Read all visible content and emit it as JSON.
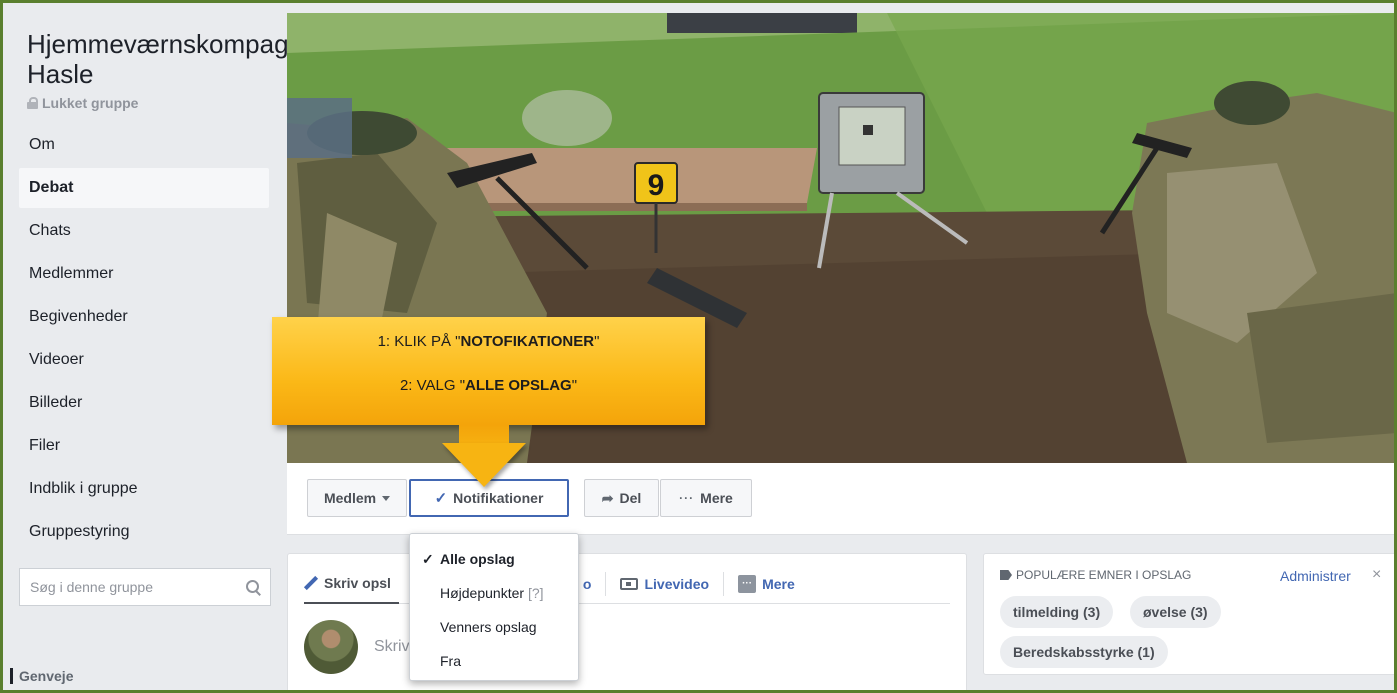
{
  "group": {
    "name": "Hjemmeværnskompagni Hasle",
    "status": "Lukket gruppe"
  },
  "nav": [
    {
      "label": "Om",
      "active": false
    },
    {
      "label": "Debat",
      "active": true
    },
    {
      "label": "Chats",
      "active": false
    },
    {
      "label": "Medlemmer",
      "active": false
    },
    {
      "label": "Begivenheder",
      "active": false
    },
    {
      "label": "Videoer",
      "active": false
    },
    {
      "label": "Billeder",
      "active": false
    },
    {
      "label": "Filer",
      "active": false
    },
    {
      "label": "Indblik i gruppe",
      "active": false
    },
    {
      "label": "Gruppestyring",
      "active": false
    }
  ],
  "search": {
    "placeholder": "Søg i denne gruppe"
  },
  "shortcuts_label": "Genveje",
  "cover": {
    "target_number": "9"
  },
  "callout": {
    "line1_prefix": "1: KLIK PÅ \"",
    "line1_bold": "NOTOFIKATIONER",
    "line1_suffix": "\"",
    "line2_prefix": "2: VALG \"",
    "line2_bold": "ALLE OPSLAG",
    "line2_suffix": "\""
  },
  "actions": {
    "member": "Medlem",
    "notifications": "Notifikationer",
    "share": "Del",
    "more": "Mere"
  },
  "dropdown": {
    "items": [
      {
        "label": "Alle opslag",
        "selected": true
      },
      {
        "label": "Højdepunkter",
        "help": "[?]"
      },
      {
        "label": "Venners opslag"
      },
      {
        "label": "Fra"
      }
    ]
  },
  "composer": {
    "tab_write": "Skriv opsl",
    "tab_photo_fragment": "o",
    "tab_live": "Livevideo",
    "tab_more": "Mere",
    "placeholder": "Skriv"
  },
  "topics": {
    "heading": "POPULÆRE EMNER I OPSLAG",
    "admin": "Administrer",
    "close": "×",
    "chips": [
      "tilmelding (3)",
      "øvelse (3)",
      "Beredskabsstyrke (1)"
    ]
  },
  "colors": {
    "accent": "#4267b2",
    "callout": "#fbb817",
    "frame": "#5a7f2e"
  }
}
